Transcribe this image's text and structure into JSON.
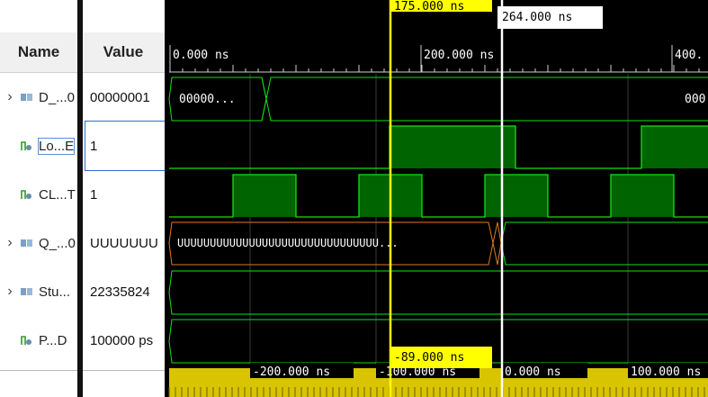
{
  "columns": {
    "name": "Name",
    "value": "Value"
  },
  "signals": [
    {
      "name": "D_...0",
      "value": "00000001",
      "kind": "bus",
      "icon": "bus-icon",
      "wave_text": "00000...",
      "wave_text_right": "000"
    },
    {
      "name": "Lo...E",
      "value": "1",
      "kind": "bit",
      "icon": "bit-icon",
      "selected": true
    },
    {
      "name": "CL...T",
      "value": "1",
      "kind": "bit",
      "icon": "bit-icon"
    },
    {
      "name": "Q_...0",
      "value": "UUUUUUU",
      "kind": "bus",
      "icon": "bus-icon",
      "wave_text": "UUUUUUUUUUUUUUUUUUUUUUUUUUUUUUU..."
    },
    {
      "name": "Stu...",
      "value": "22335824",
      "kind": "bus",
      "icon": "bus-icon"
    },
    {
      "name": "P...D",
      "value": "100000 ps",
      "kind": "bit",
      "icon": "bit-icon"
    }
  ],
  "time_axis": {
    "labels": [
      "0.000 ns",
      "200.000 ns",
      "400."
    ]
  },
  "cursors": {
    "yellow": {
      "label": "175.000 ns",
      "color": "#ffff00"
    },
    "white": {
      "label": "264.000 ns",
      "color": "#ffffff"
    },
    "delta": {
      "label": "-89.000 ns"
    }
  },
  "relative_axis": {
    "labels": [
      "-200.000 ns",
      "-100.000 ns",
      "0.000 ns",
      "100.000 ns"
    ]
  },
  "colors": {
    "wave": "#14e014",
    "wave_fill": "#006400",
    "bus_unknown": "#e07a1f",
    "ruler": "#d8c400"
  }
}
